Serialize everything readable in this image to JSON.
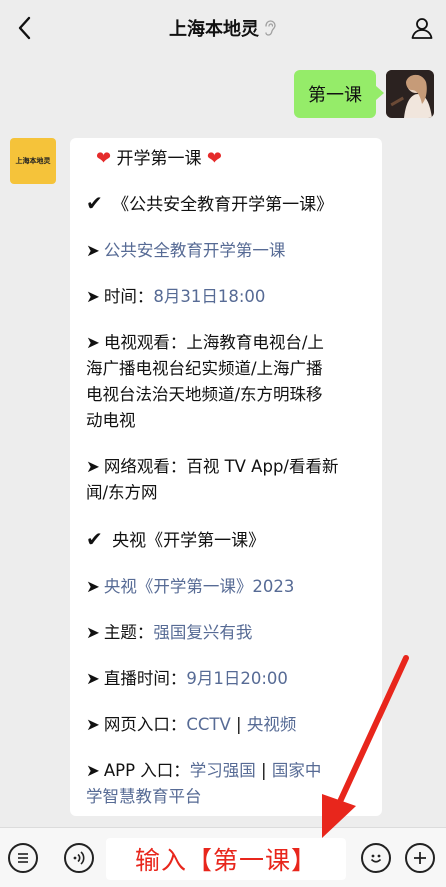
{
  "header": {
    "title": "上海本地灵"
  },
  "outgoing": {
    "text": "第一课"
  },
  "incoming": {
    "avatar_text": "上海本地灵",
    "heading": "开学第一课",
    "section1_title": "《公共安全教育开学第一课》",
    "section1_link": "公共安全教育开学第一课",
    "time_label": "时间：",
    "time_value": "8月31日18:00",
    "tv_label": "电视观看：",
    "tv_value_1": "上海教育电视台/上",
    "tv_value_2": "海广播电视台纪实频道/上海广播",
    "tv_value_3": "电视台法治天地频道/东方明珠移",
    "tv_value_4": "动电视",
    "web_label": "网络观看：",
    "web_value_1": "百视 TV App/看看新",
    "web_value_2": "闻/东方网",
    "section2_title": "央视《开学第一课》",
    "section2_link": "央视《开学第一课》2023",
    "theme_label": "主题：",
    "theme_value": "强国复兴有我",
    "live_label": "直播时间：",
    "live_value": "9月1日20:00",
    "webpage_label": "网页入口：",
    "webpage_link1": "CCTV",
    "separator": "|",
    "webpage_link2": "央视频",
    "app_label": "APP 入口：",
    "app_link1": "学习强国",
    "app_link2_a": "国家中",
    "app_link2_b": "学智慧教育平台"
  },
  "input_bar": {
    "input_text": "输入【第一课】"
  },
  "icons": {
    "back": "chevron-left-icon",
    "profile": "person-icon",
    "mute": "ear-icon",
    "menu": "list-icon",
    "voice": "voice-icon",
    "emoji": "smiley-icon",
    "plus": "plus-icon"
  },
  "colors": {
    "background": "#ededed",
    "bubble_out": "#95ec69",
    "bubble_in": "#ffffff",
    "link": "#576b95",
    "annotation": "#e8261c",
    "avatar_bot": "#f5c33a"
  }
}
